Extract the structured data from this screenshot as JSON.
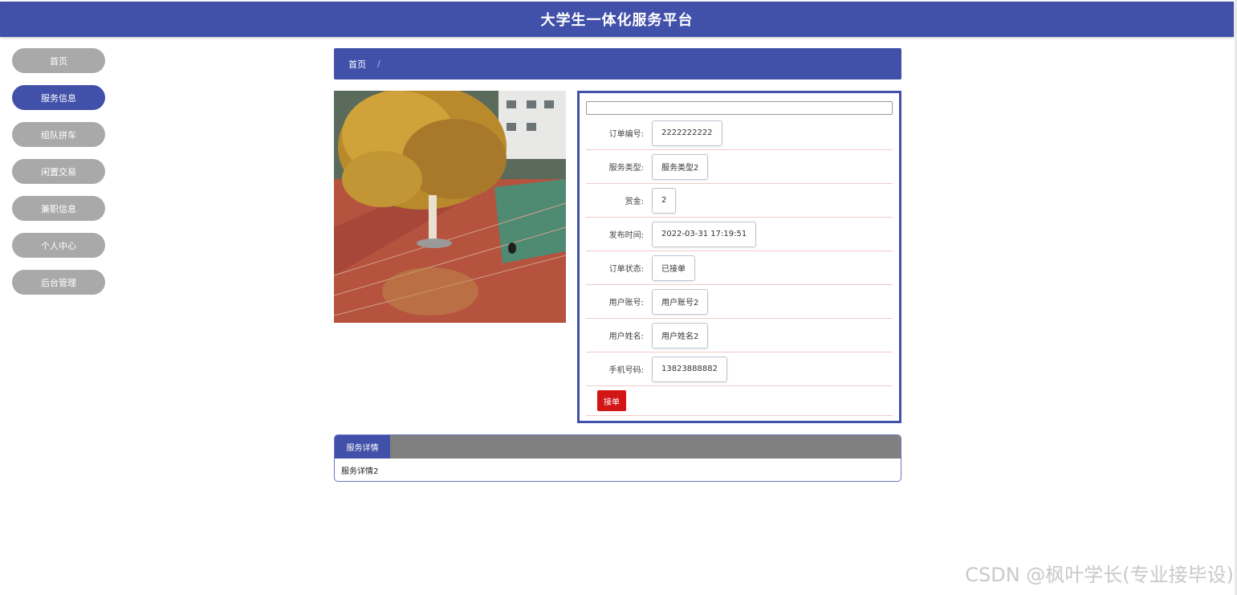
{
  "header": {
    "title": "大学生一体化服务平台"
  },
  "sidebar": {
    "items": [
      {
        "label": "首页"
      },
      {
        "label": "服务信息"
      },
      {
        "label": "组队拼车"
      },
      {
        "label": "闲置交易"
      },
      {
        "label": "兼职信息"
      },
      {
        "label": "个人中心"
      },
      {
        "label": "后台管理"
      }
    ],
    "active_index": 1
  },
  "breadcrumb": {
    "home": "首页",
    "separator": "/"
  },
  "detail": {
    "fields": [
      {
        "label": "订单编号:",
        "value": "2222222222"
      },
      {
        "label": "服务类型:",
        "value": "服务类型2"
      },
      {
        "label": "赏金:",
        "value": "2"
      },
      {
        "label": "发布时间:",
        "value": "2022-03-31 17:19:51"
      },
      {
        "label": "订单状态:",
        "value": "已接单"
      },
      {
        "label": "用户账号:",
        "value": "用户账号2"
      },
      {
        "label": "用户姓名:",
        "value": "用户姓名2"
      },
      {
        "label": "手机号码:",
        "value": "13823888882"
      }
    ],
    "accept_label": "接单"
  },
  "tabs": {
    "active_label": "服务详情",
    "content": "服务详情2"
  },
  "watermark": "CSDN @枫叶学长(专业接毕设)",
  "colors": {
    "primary": "#4150a9",
    "inactive": "#a9a9a9",
    "danger": "#d21515"
  }
}
